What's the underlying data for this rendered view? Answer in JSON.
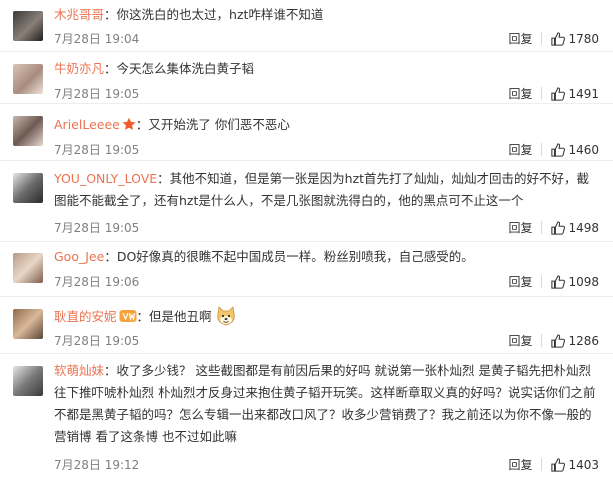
{
  "comments": [
    {
      "user": "木兆哥哥",
      "text": "你这洗白的也太过，hzt咋样谁不知道",
      "time": "7月28日 19:04",
      "reply": "回复",
      "likes": "1780",
      "badge": ""
    },
    {
      "user": "牛奶亦凡",
      "text": "今天怎么集体洗白黄子韬",
      "time": "7月28日 19:05",
      "reply": "回复",
      "likes": "1491",
      "badge": ""
    },
    {
      "user": "ArielLeeee",
      "text": "又开始洗了 你们恶不恶心",
      "time": "7月28日 19:05",
      "reply": "回复",
      "likes": "1460",
      "badge": "star-icon"
    },
    {
      "user": "YOU_ONLY_LOVE",
      "text": "其他不知道，但是第一张是因为hzt首先打了灿灿，灿灿才回击的好不好，截图能不能截全了，还有hzt是什么人，不是几张图就洗得白的，他的黑点可不止这一个",
      "time": "7月28日 19:05",
      "reply": "回复",
      "likes": "1498",
      "badge": ""
    },
    {
      "user": "Goo_Jee",
      "text": "DO好像真的很瞧不起中国成员一样。粉丝别喷我，自己感受的。",
      "time": "7月28日 19:06",
      "reply": "回复",
      "likes": "1098",
      "badge": ""
    },
    {
      "user": "耿直的安妮",
      "text": "但是他丑啊",
      "time": "7月28日 19:05",
      "reply": "回复",
      "likes": "1286",
      "badge": "member-icon"
    },
    {
      "user": "软萌灿妹",
      "text": "收了多少钱？ 这些截图都是有前因后果的好吗 就说第一张朴灿烈 是黄子韬先把朴灿烈往下推吓唬朴灿烈 朴灿烈才反身过来抱住黄子韬开玩笑。这样断章取义真的好吗？说实话你们之前不都是黑黄子韬的吗？怎么专辑一出来都改口风了？收多少营销费了？我之前还以为你不像一般的营销博 看了这条博 也不过如此嘛",
      "time": "7月28日 19:12",
      "reply": "回复",
      "likes": "1403",
      "badge": ""
    }
  ],
  "colors": {
    "username": "#eb7350",
    "text": "#333333",
    "time": "#808080"
  },
  "icons": {
    "like": "thumbs-up-icon",
    "doge": "doge-emoji-icon"
  }
}
